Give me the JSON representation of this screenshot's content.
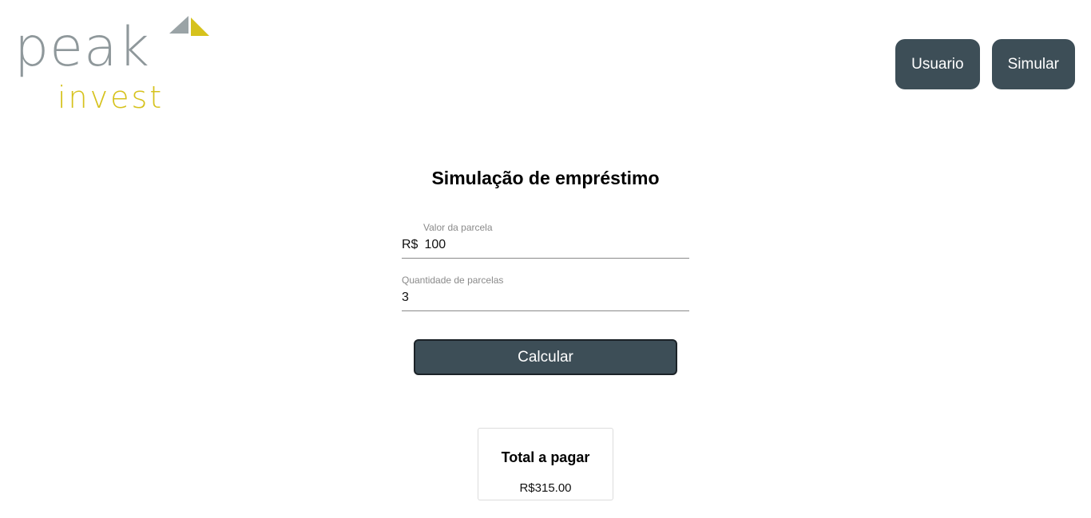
{
  "logo": {
    "word_top": "peak",
    "word_bottom": "invest",
    "mark_colors": {
      "left": "#9aa3a6",
      "right": "#d6c21c"
    }
  },
  "nav": {
    "items": [
      {
        "label": "Usuario"
      },
      {
        "label": "Simular"
      }
    ]
  },
  "form": {
    "title": "Simulação de empréstimo",
    "installment_value": {
      "label": "Valor da parcela",
      "prefix": "R$",
      "value": "100"
    },
    "installment_count": {
      "label": "Quantidade de parcelas",
      "value": "3"
    },
    "calculate_label": "Calcular"
  },
  "result": {
    "title": "Total a pagar",
    "value": "R$315.00"
  },
  "colors": {
    "primary": "#3d4e57",
    "accent_yellow": "#d6c21c",
    "logo_gray": "#8f989b"
  }
}
